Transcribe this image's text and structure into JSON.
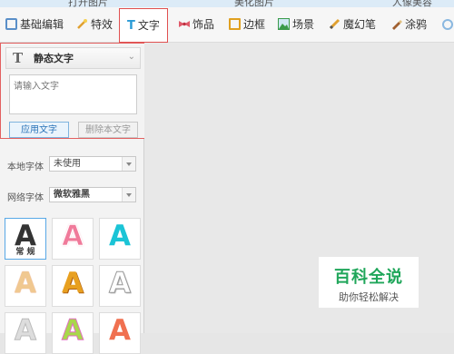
{
  "top_tabs": [
    "打开图片",
    "美化图片",
    "人像美容"
  ],
  "toolbar": {
    "items": [
      {
        "label": "基础编辑",
        "icon": "basic-edit-icon",
        "color": "#5a8fc8"
      },
      {
        "label": "特效",
        "icon": "effects-wand-icon",
        "color": "#e0a030"
      },
      {
        "label": "文字",
        "icon": "text-t-icon",
        "color": "#2a9bd6"
      },
      {
        "label": "饰品",
        "icon": "bow-icon",
        "color": "#e05a6a"
      },
      {
        "label": "边框",
        "icon": "frame-icon",
        "color": "#e0a020"
      },
      {
        "label": "场景",
        "icon": "scene-icon",
        "color": "#3a9a4a"
      },
      {
        "label": "魔幻笔",
        "icon": "magic-pen-icon",
        "color": "#e0a030"
      },
      {
        "label": "涂鸦",
        "icon": "graffiti-icon",
        "color": "#a06030"
      }
    ]
  },
  "static_text_panel": {
    "title": "静态文字",
    "placeholder": "请输入文字",
    "apply_label": "应用文字",
    "delete_label": "删除本文字"
  },
  "fonts": {
    "local_label": "本地字体",
    "local_value": "未使用",
    "network_label": "网络字体",
    "network_value": "微软雅黑"
  },
  "styles": [
    {
      "glyph": "A",
      "sub": "常 规",
      "color": "#333333"
    },
    {
      "glyph": "A",
      "sub": "",
      "color": "#f07a9a"
    },
    {
      "glyph": "A",
      "sub": "",
      "color": "#1bc4d6"
    },
    {
      "glyph": "A",
      "sub": "",
      "color": "#f0c890"
    },
    {
      "glyph": "A",
      "sub": "",
      "color": "#e8a020"
    },
    {
      "glyph": "A",
      "sub": "",
      "color": "#dddddd"
    },
    {
      "glyph": "A",
      "sub": "",
      "color": "#cccccc"
    },
    {
      "glyph": "A",
      "sub": "",
      "color": "#a8d84a"
    },
    {
      "glyph": "A",
      "sub": "",
      "color": "#f07050"
    }
  ],
  "watermark": {
    "title": "百科全说",
    "subtitle": "助你轻松解决"
  }
}
